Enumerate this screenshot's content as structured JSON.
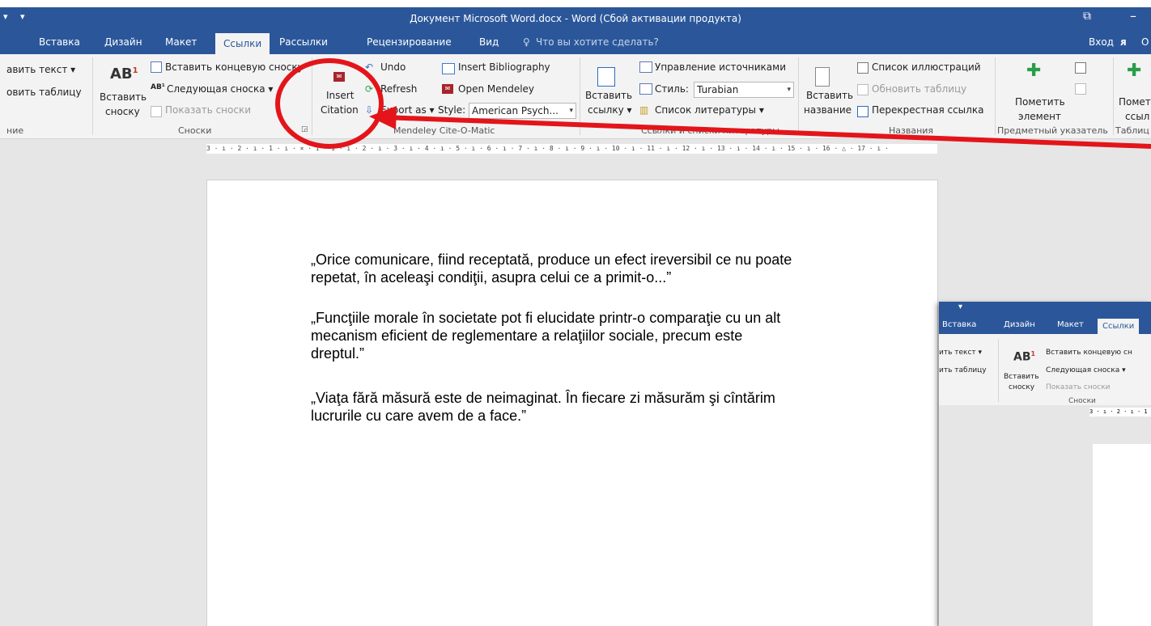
{
  "window": {
    "title": "Документ Microsoft Word.docx - Word (Сбой активации продукта)",
    "minimize_glyph": "–",
    "restore_glyph": "⧉"
  },
  "tabs": [
    "Вставка",
    "Дизайн",
    "Макет",
    "Ссылки",
    "Рассылки",
    "Рецензирование",
    "Вид"
  ],
  "active_tab": "Ссылки",
  "tell_me": "Что вы хотите сделать?",
  "sign_in": "Вход",
  "share_partial": "О",
  "ribbon": {
    "toc": {
      "add_text": "авить текст",
      "update_table": "овить таблицу",
      "group_label": "ние"
    },
    "footnotes": {
      "ab_glyph": "AB",
      "insert_footnote_line1": "Вставить",
      "insert_footnote_line2": "сноску",
      "insert_endnote": "Вставить концевую сноску",
      "next_footnote": "Следующая сноска",
      "show_notes": "Показать сноски",
      "group_label": "Сноски"
    },
    "mendeley": {
      "insert_citation_line1": "Insert",
      "insert_citation_line2": "Citation",
      "undo": "Undo",
      "refresh": "Refresh",
      "export_as": "Export as",
      "insert_bibliography": "Insert Bibliography",
      "open_mendeley": "Open Mendeley",
      "style_label": "Style:",
      "style_value": "American Psych...",
      "group_label": "Mendeley Cite-O-Matic"
    },
    "citations": {
      "insert_link_line1": "Вставить",
      "insert_link_line2": "ссылку",
      "manage_sources": "Управление источниками",
      "style_label": "Стиль:",
      "style_value": "Turabian",
      "bibliography": "Список литературы",
      "group_label": "Ссылки и списки литературы"
    },
    "captions": {
      "insert_caption_line1": "Вставить",
      "insert_caption_line2": "название",
      "table_of_figures": "Список иллюстраций",
      "update_table": "Обновить таблицу",
      "cross_reference": "Перекрестная ссылка",
      "group_label": "Названия"
    },
    "index": {
      "mark_entry_line1": "Пометить",
      "mark_entry_line2": "элемент",
      "group_label": "Предметный указатель"
    },
    "authorities": {
      "mark_citation_line1": "Помет",
      "mark_citation_line2": "ссыл",
      "group_label": "Таблиц"
    }
  },
  "ruler_text": "3 · ı · 2 · ı · 1 · ı · ⨯ · ı · 1 · ı · 2 · ı · 3 · ı · 4 · ı · 5 · ı · 6 · ı · 7 · ı · 8 · ı · 9 · ı · 10 · ı · 11 · ı · 12 · ı · 13 · ı · 14 · ı · 15 · ı · 16 · △ · 17 · ı ·",
  "document": {
    "paragraphs": [
      [
        "„Orice comunicare, fiind receptată, produce un efect  ireversibil ce nu poate",
        "repetat, în aceleaşi condiţii, asupra celui ce a primit-o...”"
      ],
      [
        "„Funcţiile morale în societate pot fi elucidate printr-o comparaţie cu un alt",
        "mecanism  eficient de reglementare a relaţiilor sociale, precum este",
        "dreptul.”"
      ],
      [
        "„Viaţa fără măsură este de neimaginat. În fiecare zi măsurăm şi cîntărim",
        "lucrurile cu care avem de a face.”"
      ]
    ]
  },
  "inset": {
    "tabs": [
      "Вставка",
      "Дизайн",
      "Макет",
      "Ссылки"
    ],
    "add_text": "ить текст",
    "update_table": "ить таблицу",
    "insert_footnote_line1": "Вставить",
    "insert_footnote_line2": "сноску",
    "insert_endnote": "Вставить концевую сн",
    "next_footnote": "Следующая сноска",
    "show_notes": "Показать сноски",
    "group_label": "Сноски",
    "ruler_text": "3 · ı · 2 · ı · 1"
  },
  "annotation": {
    "color": "#e3151a"
  }
}
